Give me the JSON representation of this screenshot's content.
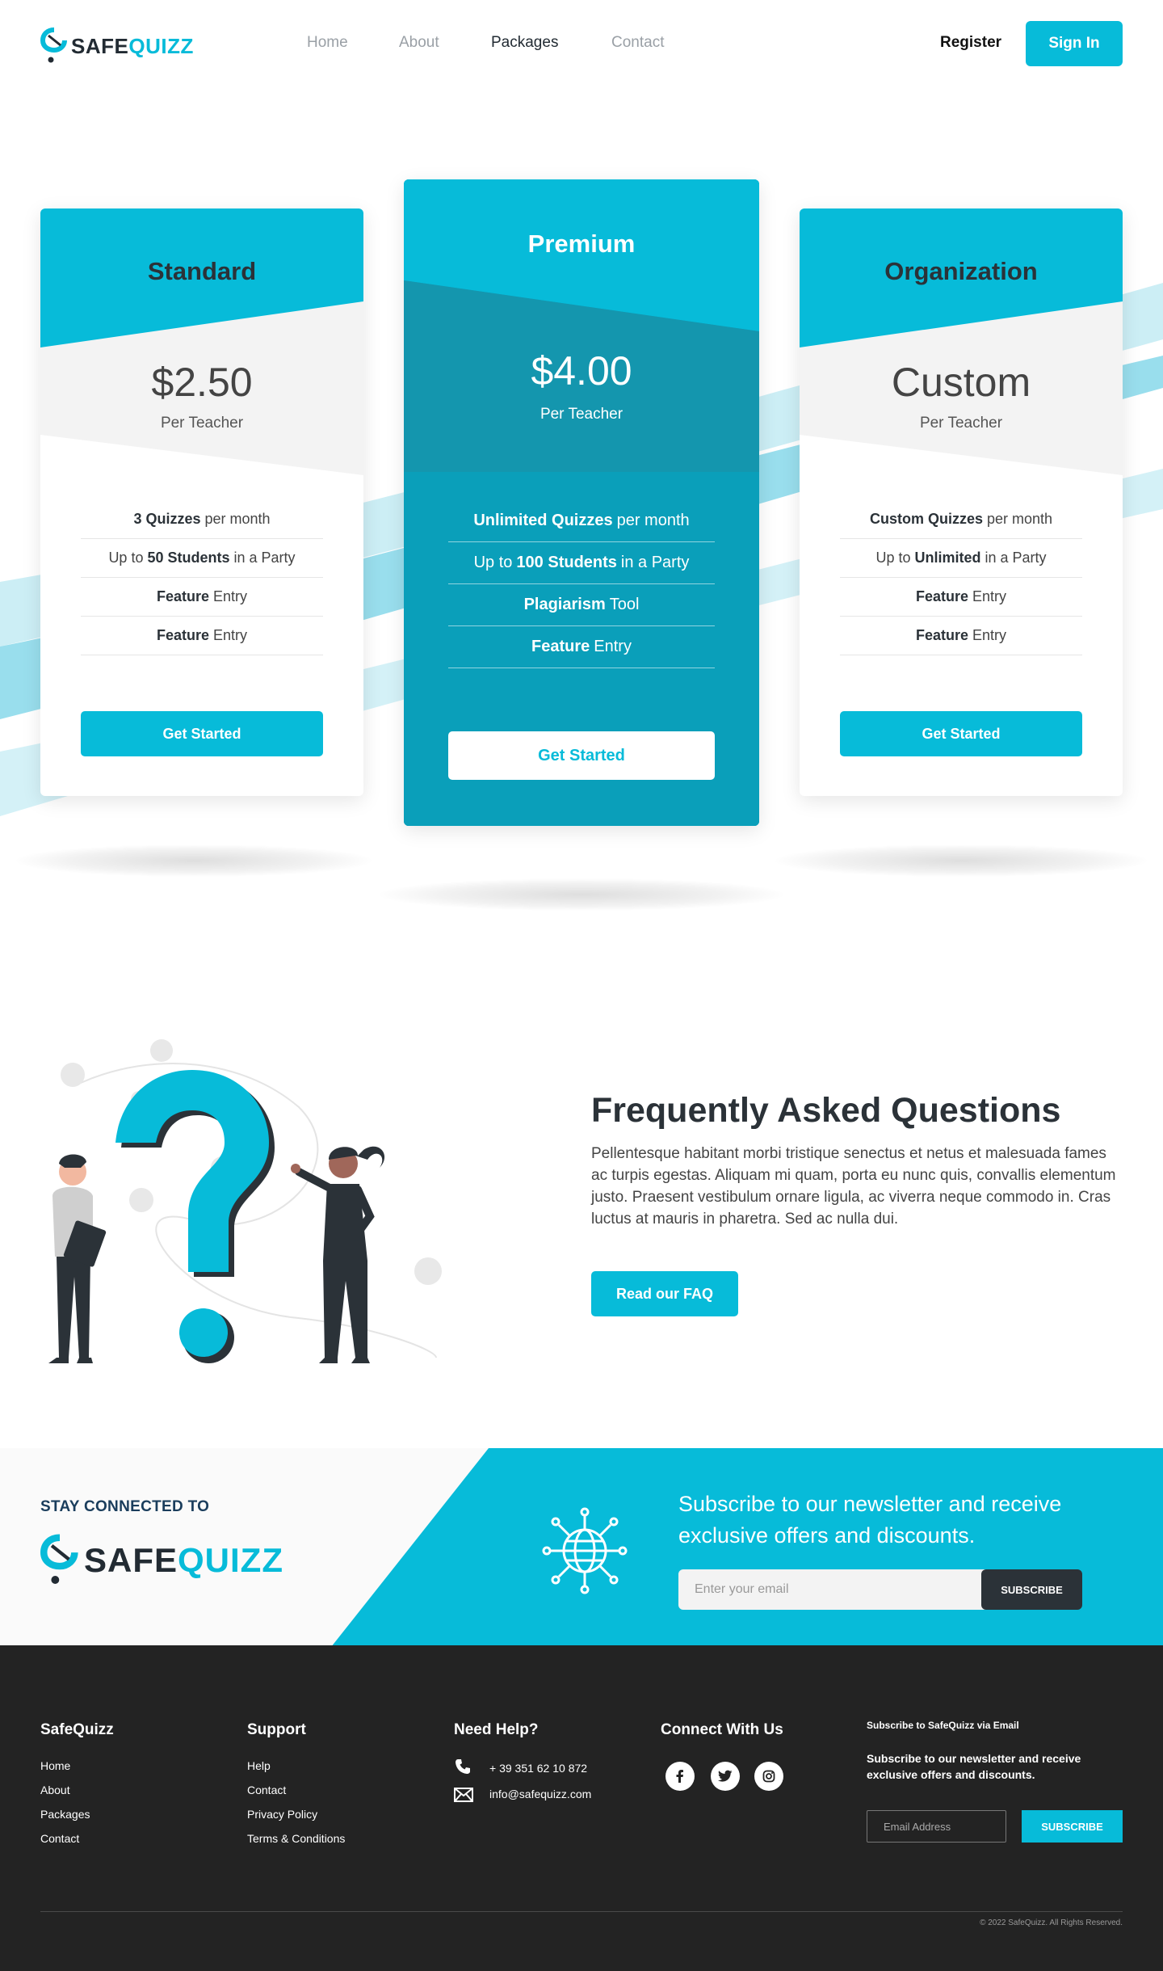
{
  "brand": {
    "part1": "SAFE",
    "part2": "QUIZZ",
    "accent_color": "#07bbd9",
    "dark_color": "#222b33"
  },
  "nav": {
    "items": [
      {
        "label": "Home",
        "active": false
      },
      {
        "label": "About",
        "active": false
      },
      {
        "label": "Packages",
        "active": true
      },
      {
        "label": "Contact",
        "active": false
      }
    ],
    "register": "Register",
    "signin": "Sign In"
  },
  "pricing": {
    "standard": {
      "name": "Standard",
      "price": "$2.50",
      "per": "Per Teacher",
      "features": [
        {
          "strong": "3 Quizzes",
          "rest": "per month",
          "pre": ""
        },
        {
          "pre": "Up to",
          "strong": "50 Students",
          "rest": "in a Party"
        },
        {
          "pre": "",
          "strong": "Feature",
          "rest": "Entry"
        },
        {
          "pre": "",
          "strong": "Feature",
          "rest": "Entry"
        }
      ],
      "cta": "Get Started"
    },
    "premium": {
      "name": "Premium",
      "price": "$4.00",
      "per": "Per Teacher",
      "features": [
        {
          "pre": "",
          "strong": "Unlimited Quizzes",
          "rest": "per month"
        },
        {
          "pre": "Up to",
          "strong": "100 Students",
          "rest": "in a Party"
        },
        {
          "pre": "",
          "strong": "Plagiarism",
          "rest": "Tool"
        },
        {
          "pre": "",
          "strong": "Feature",
          "rest": "Entry"
        }
      ],
      "cta": "Get Started"
    },
    "organization": {
      "name": "Organization",
      "price": "Custom",
      "per": "Per Teacher",
      "features": [
        {
          "pre": "",
          "strong": "Custom Quizzes",
          "rest": "per month"
        },
        {
          "pre": "Up to",
          "strong": "Unlimited",
          "rest": "in a Party"
        },
        {
          "pre": "",
          "strong": "Feature",
          "rest": "Entry"
        },
        {
          "pre": "",
          "strong": "Feature",
          "rest": "Entry"
        }
      ],
      "cta": "Get Started"
    }
  },
  "faq": {
    "title": "Frequently Asked Questions",
    "text": "Pellentesque habitant morbi tristique senectus et netus et malesuada fames ac turpis egestas. Aliquam mi quam, porta eu nunc quis, convallis elementum justo. Praesent vestibulum ornare ligula, ac viverra neque commodo in. Cras luctus at mauris in pharetra. Sed ac nulla dui.",
    "button": "Read our FAQ"
  },
  "newsletter": {
    "stay": "STAY CONNECTED TO",
    "title": "Subscribe to our newsletter and receive exclusive offers and discounts.",
    "placeholder": "Enter your email",
    "button": "SUBSCRIBE"
  },
  "footer": {
    "col1": {
      "title": "SafeQuizz",
      "links": [
        "Home",
        "About",
        "Packages",
        "Contact"
      ]
    },
    "col2": {
      "title": "Support",
      "links": [
        "Help",
        "Contact",
        "Privacy Policy",
        "Terms & Conditions"
      ]
    },
    "col3": {
      "title": "Need Help?",
      "phone": "+ 39 351 62 10 872",
      "email": "info@safequizz.com"
    },
    "col4": {
      "title": "Connect With Us",
      "socials": [
        "facebook-icon",
        "twitter-icon",
        "instagram-icon"
      ]
    },
    "col5": {
      "title": "Subscribe to SafeQuizz via Email",
      "text": "Subscribe to our newsletter and receive exclusive offers and discounts.",
      "placeholder": "Email Address",
      "button": "SUBSCRIBE"
    },
    "copyright": "© 2022 SafeQuizz. All Rights Reserved."
  }
}
